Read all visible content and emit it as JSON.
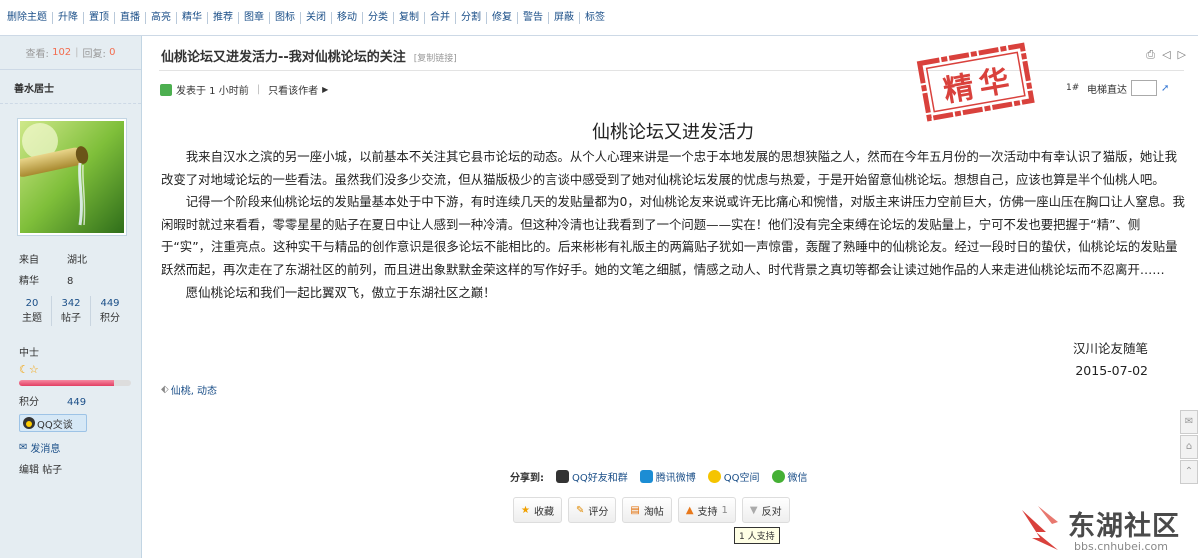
{
  "mod_actions": [
    "删除主题",
    "升降",
    "置顶",
    "直播",
    "高亮",
    "精华",
    "推荐",
    "图章",
    "图标",
    "关闭",
    "移动",
    "分类",
    "复制",
    "合并",
    "分割",
    "修复",
    "警告",
    "屏蔽",
    "标签"
  ],
  "stats": {
    "views_label": "查看:",
    "views": "102",
    "replies_label": "回复:",
    "replies": "0"
  },
  "author": {
    "name": "善水居士",
    "from_label": "来自",
    "from": "湖北",
    "digest_label": "精华",
    "digest": "8",
    "counts": [
      {
        "value": "20",
        "label": "主题"
      },
      {
        "value": "342",
        "label": "帖子"
      },
      {
        "value": "449",
        "label": "积分"
      }
    ],
    "rank": "中士",
    "rank_stars": "☾☆",
    "progress": 0.85,
    "points_label": "积分",
    "points": "449",
    "qq_label": "QQ交谈",
    "msg_label": "发消息",
    "edit_label": "编辑",
    "edit_link": "帖子"
  },
  "thread": {
    "title": "仙桃论坛又进发活力--我对仙桃论坛的关注",
    "copy_link": "[复制链接]",
    "posted": "发表于 1 小时前",
    "only_author": "只看该作者",
    "floor": "1#",
    "elevator": "电梯直达",
    "stamp": "精华"
  },
  "post": {
    "heading": "仙桃论坛又进发活力",
    "paragraphs": [
      "我来自汉水之滨的另一座小城，以前基本不关注其它县市论坛的动态。从个人心理来讲是一个忠于本地发展的思想狭隘之人，然而在今年五月份的一次活动中有幸认识了猫版，她让我改变了对地域论坛的一些看法。虽然我们没多少交流，但从猫版极少的言谈中感受到了她对仙桃论坛发展的忧虑与热爱，于是开始留意仙桃论坛。想想自己，应该也算是半个仙桃人吧。",
      "记得一个阶段来仙桃论坛的发贴量基本处于中下游，有时连续几天的发贴量都为0，对仙桃论友来说或许无比痛心和惋惜，对版主来讲压力空前巨大，仿佛一座山压在胸口让人窒息。我闲暇时就过来看看，零零星星的贴子在夏日中让人感到一种冷清。但这种冷清也让我看到了一个问题——实在！他们没有完全束缚在论坛的发贴量上，宁可不发也要把握于“精”、侧于“实”，注重亮点。这种实干与精品的创作意识是很多论坛不能相比的。后来彬彬有礼版主的两篇贴子犹如一声惊雷，轰醒了熟睡中的仙桃论友。经过一段时日的蛰伏，仙桃论坛的发贴量跃然而起，再次走在了东湖社区的前列，而且进出象默默金荣这样的写作好手。她的文笔之细腻，情感之动人、时代背景之真切等都会让读过她作品的人来走进仙桃论坛而不忍离开……",
      "愿仙桃论坛和我们一起比翼双飞，傲立于东湖社区之巅！"
    ],
    "signature": "汉川论友随笔",
    "date": "2015-07-02",
    "tags": "仙桃, 动态"
  },
  "share": {
    "label": "分享到:",
    "targets": [
      "QQ好友和群",
      "腾讯微博",
      "QQ空间",
      "微信"
    ]
  },
  "actions": [
    "收藏",
    "评分",
    "淘帖",
    "支持",
    "反对"
  ],
  "support_count": "1",
  "tooltip": "1 人支持",
  "logo": {
    "text": "东湖社区",
    "url": "bbs.cnhubei.com"
  },
  "colors": {
    "link": "#1b4f88",
    "sidebar": "#e5edf2",
    "stamp": "#d9413c",
    "accent": "#f26c4f"
  }
}
